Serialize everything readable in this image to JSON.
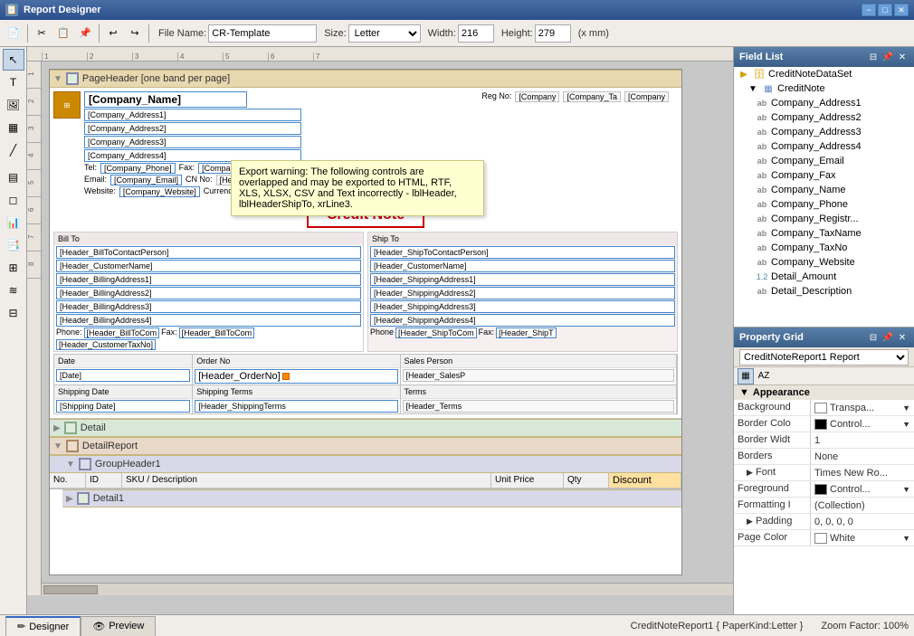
{
  "titleBar": {
    "title": "Report Designer",
    "minimizeLabel": "−",
    "maximizeLabel": "□",
    "closeLabel": "✕"
  },
  "toolbar": {
    "fileNameLabel": "File Name:",
    "fileName": "CR-Template",
    "sizeLabel": "Size:",
    "sizeValue": "Letter",
    "widthLabel": "Width:",
    "widthValue": "216",
    "heightLabel": "Height:",
    "heightValue": "279",
    "unitValue": "(x mm)"
  },
  "fieldList": {
    "title": "Field List",
    "rootNode": "CreditNoteDataSet",
    "tableNode": "CreditNote",
    "fields": [
      "Company_Address1",
      "Company_Address2",
      "Company_Address3",
      "Company_Address4",
      "Company_Email",
      "Company_Fax",
      "Company_Name",
      "Company_Phone",
      "Company_Registr...",
      "Company_TaxName",
      "Company_TaxNo",
      "Company_Website",
      "Detail_Amount",
      "Detail_Description"
    ]
  },
  "propertyGrid": {
    "title": "Property Grid",
    "objectName": "CreditNoteReport1",
    "objectType": "Report",
    "categories": {
      "appearance": {
        "label": "Appearance",
        "expanded": true,
        "properties": [
          {
            "name": "Background",
            "value": "Transpa...",
            "hasColor": true,
            "colorHex": "#ffffff"
          },
          {
            "name": "Border Colo",
            "value": "Control...",
            "hasColor": true,
            "colorHex": "#000000"
          },
          {
            "name": "Border Widt",
            "value": "1"
          },
          {
            "name": "Borders",
            "value": "None"
          }
        ]
      },
      "font": {
        "label": "Font",
        "expanded": false,
        "value": "Times New Ro..."
      },
      "foreground": {
        "label": "Foreground",
        "value": "Control...",
        "hasColor": true,
        "colorHex": "#000000"
      },
      "formatting": {
        "label": "Formatting I",
        "value": "(Collection)"
      },
      "padding": {
        "label": "Padding",
        "value": "0, 0, 0, 0"
      },
      "pageColor": {
        "label": "Page Color",
        "value": "White"
      }
    }
  },
  "canvas": {
    "pageHeader": {
      "label": "PageHeader [one band per page]",
      "companyName": "[Company_Name]",
      "companyAddress1": "[Company_Address1]",
      "companyAddress2": "[Company_Address2]",
      "companyAddress3": "[Company_Address3]",
      "companyAddress4": "[Company_Address4]",
      "regNoLabel": "Reg No:",
      "telLabel": "Tel:",
      "companyPhone": "[Company_Phone]",
      "faxLabel": "Fax:",
      "companyFax": "[Company_Fax]",
      "emailLabel": "Email:",
      "companyEmail": "[Company_Email]",
      "websiteLabel": "Website:",
      "companyWebsite": "[Company_Website]",
      "cnNoLabel": "CN No:",
      "currencyLabel": "Currency:",
      "creditNoteTitle": "Credit Note",
      "billToLabel": "Bill To",
      "shipToLabel": "Ship To",
      "headerBillToContactPerson": "[Header_BillToContactPerson]",
      "headerShipToContactPerson": "[Header_ShipToContactPerson]",
      "headerCustomerName1": "[Header_CustomerName]",
      "headerCustomerName2": "[Header_CustomerName]",
      "headerBillingAddress1": "[Header_BillingAddress1]",
      "headerShippingAddress1": "[Header_ShippingAddress1]",
      "headerBillingAddress2": "[Header_BillingAddress2]",
      "headerShippingAddress2": "[Header_ShippingAddress2]",
      "headerBillingAddress3": "[Header_BillingAddress3]",
      "headerShippingAddress3": "[Header_ShippingAddress3]",
      "headerBillingAddress4": "[Header_BillingAddress4]",
      "headerShippingAddress4": "[Header_ShippingAddress4]",
      "phoneLabel1": "Phone:",
      "phoneLabel2": "Phone",
      "faxLabel2": "Fax:",
      "faxLabel3": "Fax:",
      "headerBillToCom": "[Header_BillToCom]",
      "headerBillToComFax": "[Header_BillToComFax]",
      "headerShipToCom": "[Header_ShipToCom]",
      "headerCustomerTaxNo": "[Header_CustomerTaxNo]",
      "dateLabel": "Date",
      "dateValue": "[Date]",
      "orderNoLabel": "Order No",
      "headerOrderNo": "[Header_OrderNo]",
      "salesPersonLabel": "Sales Person",
      "headerSalesP": "[Header_SalesP",
      "shippingDateLabel": "Shipping Date",
      "shippingDateValue": "[Shipping Date]",
      "shippingTermsLabel": "Shipping Terms",
      "headerShippingTerms": "[Header_ShippingTerms",
      "termsLabel": "Terms",
      "headerTerms": "[Header_Terms"
    },
    "tooltip": {
      "text": "Export warning: The following controls are overlapped and may be exported to HTML, RTF, XLS, XLSX, CSV and Text incorrectly - lblHeader, lblHeaderShipTo, xrLine3."
    },
    "detail": {
      "label": "Detail"
    },
    "detailReport": {
      "label": "DetailReport"
    },
    "groupHeader1": {
      "label": "GroupHeader1",
      "columns": [
        "No.",
        "ID",
        "SKU / Description",
        "Unit Price",
        "Qty",
        "Discount"
      ]
    },
    "detail1": {
      "label": "Detail1"
    }
  },
  "statusBar": {
    "tabs": [
      {
        "label": "Designer",
        "icon": "pencil",
        "active": true
      },
      {
        "label": "Preview",
        "icon": "eye",
        "active": false
      }
    ],
    "reportInfo": "CreditNoteReport1 { PaperKind:Letter }",
    "zoomInfo": "Zoom Factor: 100%"
  }
}
